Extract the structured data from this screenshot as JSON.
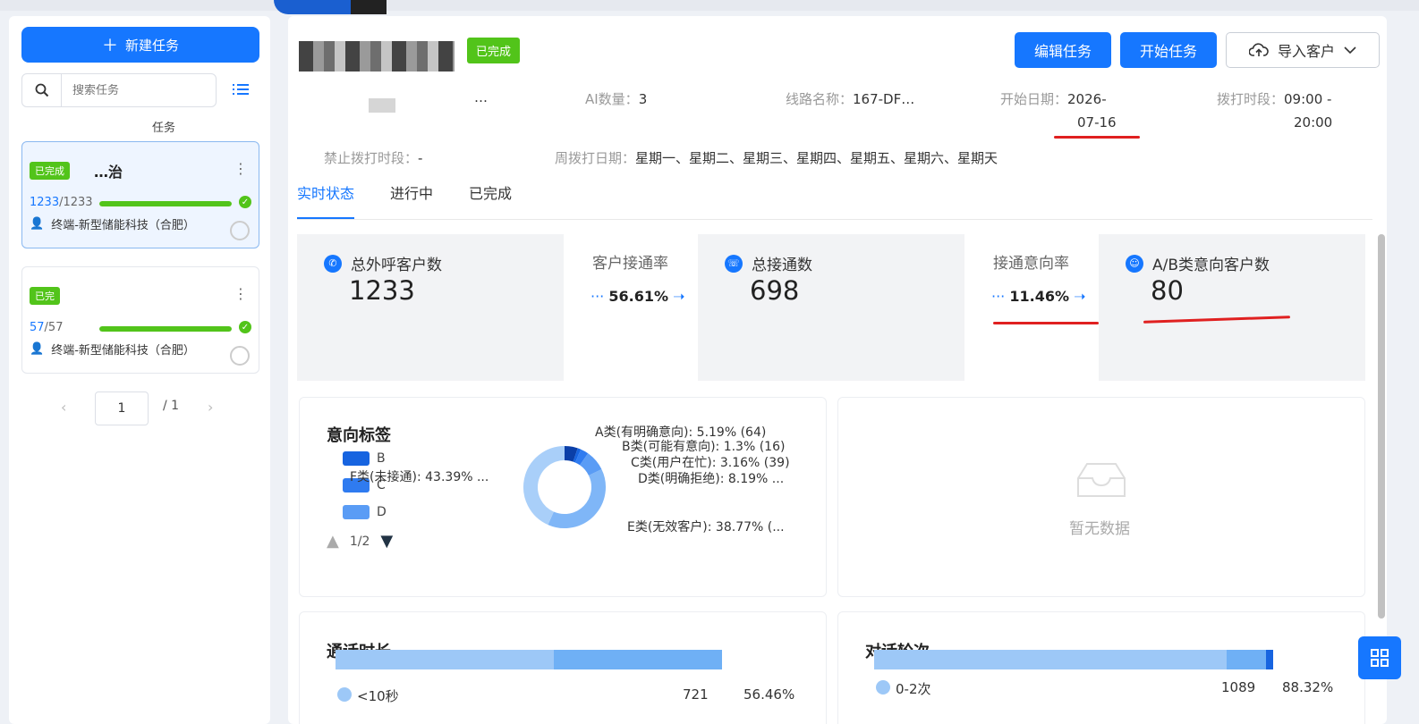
{
  "sidebar": {
    "new_task_label": "新建任务",
    "search_placeholder": "搜索任务",
    "group_label": "任务",
    "tasks": [
      {
        "status": "已完成",
        "title": "…治",
        "count_done": "1233",
        "count_total": "/1233",
        "progress": 1.0,
        "owner": "终端-新型储能科技（合肥）"
      },
      {
        "status": "已完",
        "title": "",
        "count_done": "57",
        "count_total": "/57",
        "progress": 1.0,
        "owner": "终端-新型储能科技（合肥）"
      }
    ],
    "pager": {
      "current": "1",
      "total": "/ 1"
    }
  },
  "header": {
    "status_tag": "已完成",
    "edit_button": "编辑任务",
    "start_button": "开始任务",
    "import_button": "导入客户"
  },
  "info": {
    "field1_value": "…",
    "ai_label": "AI数量：",
    "ai_value": "3",
    "line_label": "线路名称：",
    "line_value": "167-DF…",
    "start_label": "开始日期：",
    "start_value_1": "2026-",
    "start_value_2": "07-16",
    "dial_label": "拨打时段：",
    "dial_value_1": "09:00 -",
    "dial_value_2": "20:00",
    "forbid_label": "禁止拨打时段：",
    "forbid_value": "-",
    "week_label": "周拨打日期：",
    "week_value": "星期一、星期二、星期三、星期四、星期五、星期六、星期天"
  },
  "tabs": [
    "实时状态",
    "进行中",
    "已完成"
  ],
  "stats": {
    "total_call_label": "总外呼客户数",
    "total_call_value": "1233",
    "connect_rate_label": "客户接通率",
    "connect_rate_value": "56.61%",
    "total_connect_label": "总接通数",
    "total_connect_value": "698",
    "intent_rate_label": "接通意向率",
    "intent_rate_value": "11.46%",
    "ab_label": "A/B类意向客户数",
    "ab_value": "80"
  },
  "intent_card": {
    "title": "意向标签",
    "legend": [
      "B",
      "C",
      "D"
    ],
    "legend_page": "1/2",
    "labels": {
      "a": "A类(有明确意向): 5.19% (64)",
      "b": "B类(可能有意向): 1.3% (16)",
      "c": "C类(用户在忙): 3.16% (39)",
      "d": "D类(明确拒绝): 8.19% ...",
      "e": "E类(无效客户): 38.77% (...",
      "f": "F类(未接通): 43.39% ..."
    }
  },
  "empty_card": {
    "text": "暂无数据"
  },
  "duration_card": {
    "title": "通话时长",
    "row_label": "<10秒",
    "row_count": "721",
    "row_pct": "56.46%"
  },
  "rounds_card": {
    "title": "对话轮次",
    "row_label": "0-2次",
    "row_count": "1089",
    "row_pct": "88.32%"
  },
  "chart_data": {
    "type": "pie",
    "title": "意向标签",
    "categories": [
      "A类(有明确意向)",
      "B类(可能有意向)",
      "C类(用户在忙)",
      "D类(明确拒绝)",
      "E类(无效客户)",
      "F类(未接通)"
    ],
    "values": [
      5.19,
      1.3,
      3.16,
      8.19,
      38.77,
      43.39
    ],
    "counts": [
      64,
      16,
      39,
      null,
      null,
      null
    ],
    "colors": [
      "#0b3fa8",
      "#1764e0",
      "#2f7bf0",
      "#5a9cf5",
      "#7fb6f7",
      "#a9cff9"
    ]
  },
  "colors": {
    "primary": "#1677ff",
    "success": "#52c41a",
    "annotation": "#e02020"
  }
}
